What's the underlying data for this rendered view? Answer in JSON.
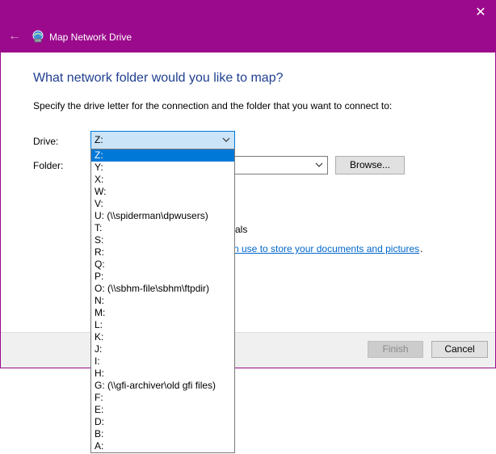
{
  "window": {
    "title": "Map Network Drive",
    "close_glyph": "✕",
    "back_glyph": "←",
    "colors": {
      "title_bar": "#9b0a8c",
      "heading": "#1f3f8f",
      "link": "#0066cc",
      "selection": "#0078d7"
    }
  },
  "main": {
    "heading": "What network folder would you like to map?",
    "instruction": "Specify the drive letter for the connection and the folder that you want to connect to:",
    "drive_label": "Drive:",
    "drive_value": "Z:",
    "folder_label": "Folder:",
    "folder_value": "",
    "browse_label": "Browse...",
    "credentials_fragment": "tials",
    "link_fragment": "n use to store your documents and pictures",
    "link_period": "."
  },
  "footer": {
    "finish_label": "Finish",
    "cancel_label": "Cancel"
  },
  "dropdown": {
    "selected": "Z:",
    "options": [
      "Z:",
      "Y:",
      "X:",
      "W:",
      "V:",
      "U: (\\\\spiderman\\dpwusers)",
      "T:",
      "S:",
      "R:",
      "Q:",
      "P:",
      "O: (\\\\sbhm-file\\sbhm\\ftpdir)",
      "N:",
      "M:",
      "L:",
      "K:",
      "J:",
      "I:",
      "H:",
      "G: (\\\\gfi-archiver\\old gfi files)",
      "F:",
      "E:",
      "D:",
      "B:",
      "A:"
    ]
  },
  "icons": {
    "app": "network-drive-icon",
    "back": "back-arrow-icon",
    "close": "close-icon",
    "chevron": "chevron-down-icon"
  }
}
